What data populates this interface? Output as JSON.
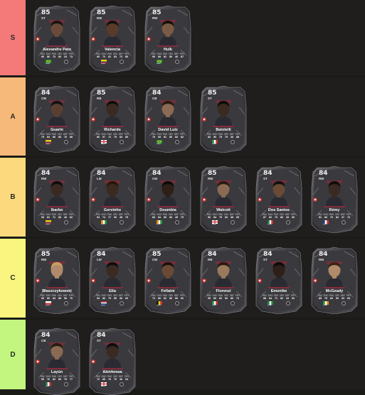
{
  "colors": {
    "background": "#1a1a17",
    "row_background": "#1f1e1c",
    "tier_S": "#f47a7a",
    "tier_A": "#f7b97a",
    "tier_B": "#fbd97c",
    "tier_C": "#f9f57e",
    "tier_D": "#c2f67e",
    "card_frame": "#3a3a3e",
    "card_accent": "#a3263a"
  },
  "stat_labels": [
    "PAC",
    "SHO",
    "PAS",
    "DRI",
    "DEF",
    "PHY"
  ],
  "tiers": [
    {
      "label": "S",
      "color": "#f47a7a",
      "cards": [
        {
          "rating": "85",
          "position": "ST",
          "name": "Alexandre Pato",
          "stats": [
            "90",
            "86",
            "73",
            "80",
            "33",
            "73"
          ],
          "flag": "brazil",
          "photo_tone": "#6b4a3a",
          "hair": "#1c120c"
        },
        {
          "rating": "85",
          "position": "RM",
          "name": "Valencia",
          "stats": [
            "90",
            "72",
            "81",
            "83",
            "72",
            "85"
          ],
          "flag": "ecuador",
          "photo_tone": "#5a3a2a",
          "hair": "#111111"
        },
        {
          "rating": "85",
          "position": "RW",
          "name": "Hulk",
          "stats": [
            "90",
            "89",
            "81",
            "80",
            "46",
            "87"
          ],
          "flag": "brazil",
          "photo_tone": "#7a5a44",
          "hair": "#171007"
        }
      ]
    },
    {
      "label": "A",
      "color": "#f7b97a",
      "cards": [
        {
          "rating": "84",
          "position": "CM",
          "name": "Guarín",
          "stats": [
            "79",
            "84",
            "80",
            "80",
            "76",
            "88"
          ],
          "flag": "colombia",
          "photo_tone": "#5a3f30",
          "hair": "#111111"
        },
        {
          "rating": "85",
          "position": "RB",
          "name": "Richards",
          "stats": [
            "86",
            "57",
            "72",
            "75",
            "84",
            "89"
          ],
          "flag": "england",
          "photo_tone": "#3a2a22",
          "hair": "#0d0d0d"
        },
        {
          "rating": "84",
          "position": "CB",
          "name": "David Luiz",
          "stats": [
            "79",
            "69",
            "81",
            "80",
            "83",
            "82"
          ],
          "flag": "brazil",
          "photo_tone": "#8a6a52",
          "hair": "#2a1a10"
        },
        {
          "rating": "85",
          "position": "ST",
          "name": "Balotelli",
          "stats": [
            "84",
            "90",
            "75",
            "79",
            "30",
            "88"
          ],
          "flag": "italy",
          "photo_tone": "#3a2a20",
          "hair": "#0c0c0c"
        }
      ]
    },
    {
      "label": "B",
      "color": "#fbd97c",
      "cards": [
        {
          "rating": "84",
          "position": "RW",
          "name": "Ibarbo",
          "stats": [
            "93",
            "81",
            "71",
            "86",
            "40",
            "82"
          ],
          "flag": "colombia",
          "photo_tone": "#3a2a22",
          "hair": "#0d0d0d"
        },
        {
          "rating": "84",
          "position": "LM",
          "name": "Gervinho",
          "stats": [
            "94",
            "74",
            "77",
            "90",
            "45",
            "75"
          ],
          "flag": "ivory-coast",
          "photo_tone": "#3a2a20",
          "hair": "#2a1608"
        },
        {
          "rating": "84",
          "position": "CM",
          "name": "Doumbia",
          "stats": [
            "83",
            "84",
            "80",
            "83",
            "45",
            "75"
          ],
          "flag": "ivory-coast",
          "photo_tone": "#2e2018",
          "hair": "#0b0b0b"
        },
        {
          "rating": "85",
          "position": "RW",
          "name": "Walcott",
          "stats": [
            "96",
            "84",
            "79",
            "83",
            "35",
            "65"
          ],
          "flag": "england",
          "photo_tone": "#8a6a52",
          "hair": "#2a1a10"
        },
        {
          "rating": "84",
          "position": "ST",
          "name": "Dos Santos",
          "stats": [
            "87",
            "82",
            "73",
            "86",
            "33",
            "69"
          ],
          "flag": "mexico",
          "photo_tone": "#6a4a34",
          "hair": "#111111"
        },
        {
          "rating": "84",
          "position": "RW",
          "name": "Rémy",
          "stats": [
            "91",
            "84",
            "70",
            "82",
            "37",
            "72"
          ],
          "flag": "france",
          "photo_tone": "#3a2a22",
          "hair": "#0d0d0d"
        }
      ]
    },
    {
      "label": "C",
      "color": "#f9f57e",
      "cards": [
        {
          "rating": "85",
          "position": "RM",
          "name": "Błaszczykowski",
          "stats": [
            "90",
            "80",
            "84",
            "88",
            "58",
            "76"
          ],
          "flag": "poland",
          "photo_tone": "#b08a6a",
          "hair": "#c8a060"
        },
        {
          "rating": "84",
          "position": "LW",
          "name": "Elia",
          "stats": [
            "94",
            "80",
            "79",
            "85",
            "36",
            "66"
          ],
          "flag": "netherlands",
          "photo_tone": "#3a2a22",
          "hair": "#0d0d0d"
        },
        {
          "rating": "85",
          "position": "CM",
          "name": "Fellaini",
          "stats": [
            "74",
            "80",
            "82",
            "80",
            "80",
            "92"
          ],
          "flag": "belgium",
          "photo_tone": "#6a4a34",
          "hair": "#1c120c"
        },
        {
          "rating": "84",
          "position": "RB",
          "name": "Florenzi",
          "stats": [
            "90",
            "80",
            "82",
            "83",
            "80",
            "72"
          ],
          "flag": "italy",
          "photo_tone": "#9a7a5c",
          "hair": "#2a1a10"
        },
        {
          "rating": "84",
          "position": "ST",
          "name": "Emenike",
          "stats": [
            "88",
            "84",
            "71",
            "82",
            "34",
            "92"
          ],
          "flag": "nigeria",
          "photo_tone": "#2e2018",
          "hair": "#0b0b0b"
        },
        {
          "rating": "84",
          "position": "RM",
          "name": "McGeady",
          "stats": [
            "85",
            "75",
            "82",
            "90",
            "33",
            "66"
          ],
          "flag": "ireland",
          "photo_tone": "#b08a6a",
          "hair": "#3a2414"
        }
      ]
    },
    {
      "label": "D",
      "color": "#c2f67e",
      "cards": [
        {
          "rating": "84",
          "position": "CB",
          "name": "Layún",
          "stats": [
            "90",
            "76",
            "82",
            "80",
            "79",
            "77"
          ],
          "flag": "mexico",
          "photo_tone": "#8a6a52",
          "hair": "#2a1a10"
        },
        {
          "rating": "84",
          "position": "ST",
          "name": "Akinfenwa",
          "stats": [
            "72",
            "85",
            "76",
            "75",
            "40",
            "94"
          ],
          "flag": "england",
          "photo_tone": "#3a2a22",
          "hair": "#0d0d0d"
        }
      ]
    }
  ]
}
